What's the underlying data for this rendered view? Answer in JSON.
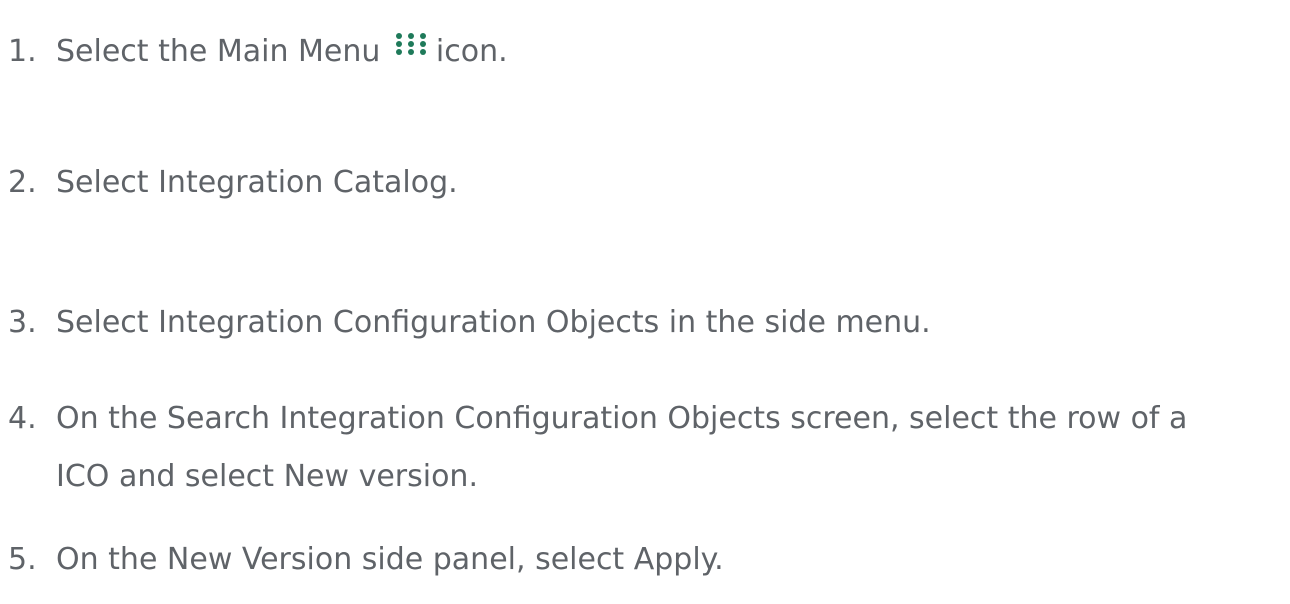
{
  "steps": [
    {
      "number": "1.",
      "before_icon": "Select the Main Menu",
      "icon": "grid-menu-icon",
      "after_icon": "icon."
    },
    {
      "number": "2.",
      "text": "Select Integration Catalog."
    },
    {
      "number": "3.",
      "text": "Select Integration Configuration Objects in the side menu."
    },
    {
      "number": "4.",
      "line1": "On the Search Integration Configuration Objects screen, select the row of a",
      "line2": "ICO and select New version."
    },
    {
      "number": "5.",
      "text": "On the New Version side panel, select Apply."
    }
  ],
  "colors": {
    "text": "#5f6368",
    "icon": "#1f7a5a"
  }
}
